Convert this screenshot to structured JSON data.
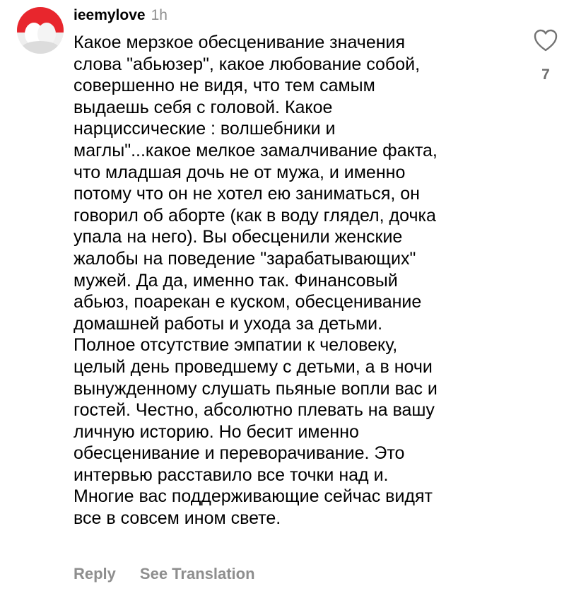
{
  "comment": {
    "username": "ieemylove",
    "timestamp": "1h",
    "text_lines": [
      "Какое мерзкое обесценивание значения",
      "слова \"абьюзер\", какое любование собой,",
      "совершенно не видя, что тем самым",
      "выдаешь себя с головой. Какое",
      "нарциссические : волшебники и",
      "маглы\"...какое мелкое замалчивание факта,",
      "что младшая дочь не от мужа, и именно",
      "потому что он не хотел ею заниматься, он",
      "говорил об аборте (как в воду глядел, дочка",
      "упала на него). Вы обесценили женские",
      "жалобы на поведение \"зарабатывающих\"",
      "мужей. Да да, именно так. Финансовый",
      "абьюз, поарекан е куском, обесценивание",
      "домашней работы и ухода за детьми.",
      "Полное отсутствие эмпатии к человеку,",
      "целый день проведшему с детьми, а в ночи",
      "вынужденному слушать пьяные вопли вас и",
      "гостей. Честно, абсолютно плевать на вашу",
      "личную историю. Но бесит именно",
      "обесценивание и переворачивание. Это",
      "интервью расставило все точки над и.",
      "Многие вас поддерживающие сейчас видят",
      "все в совсем ином свете."
    ],
    "like_count": "7",
    "actions": {
      "reply": "Reply",
      "see_translation": "See Translation"
    },
    "icons": {
      "avatar": "avatar-image",
      "like": "heart-outline-icon"
    },
    "colors": {
      "text": "#000000",
      "muted": "#8e8e8e",
      "avatar_red": "#e8262d"
    }
  }
}
